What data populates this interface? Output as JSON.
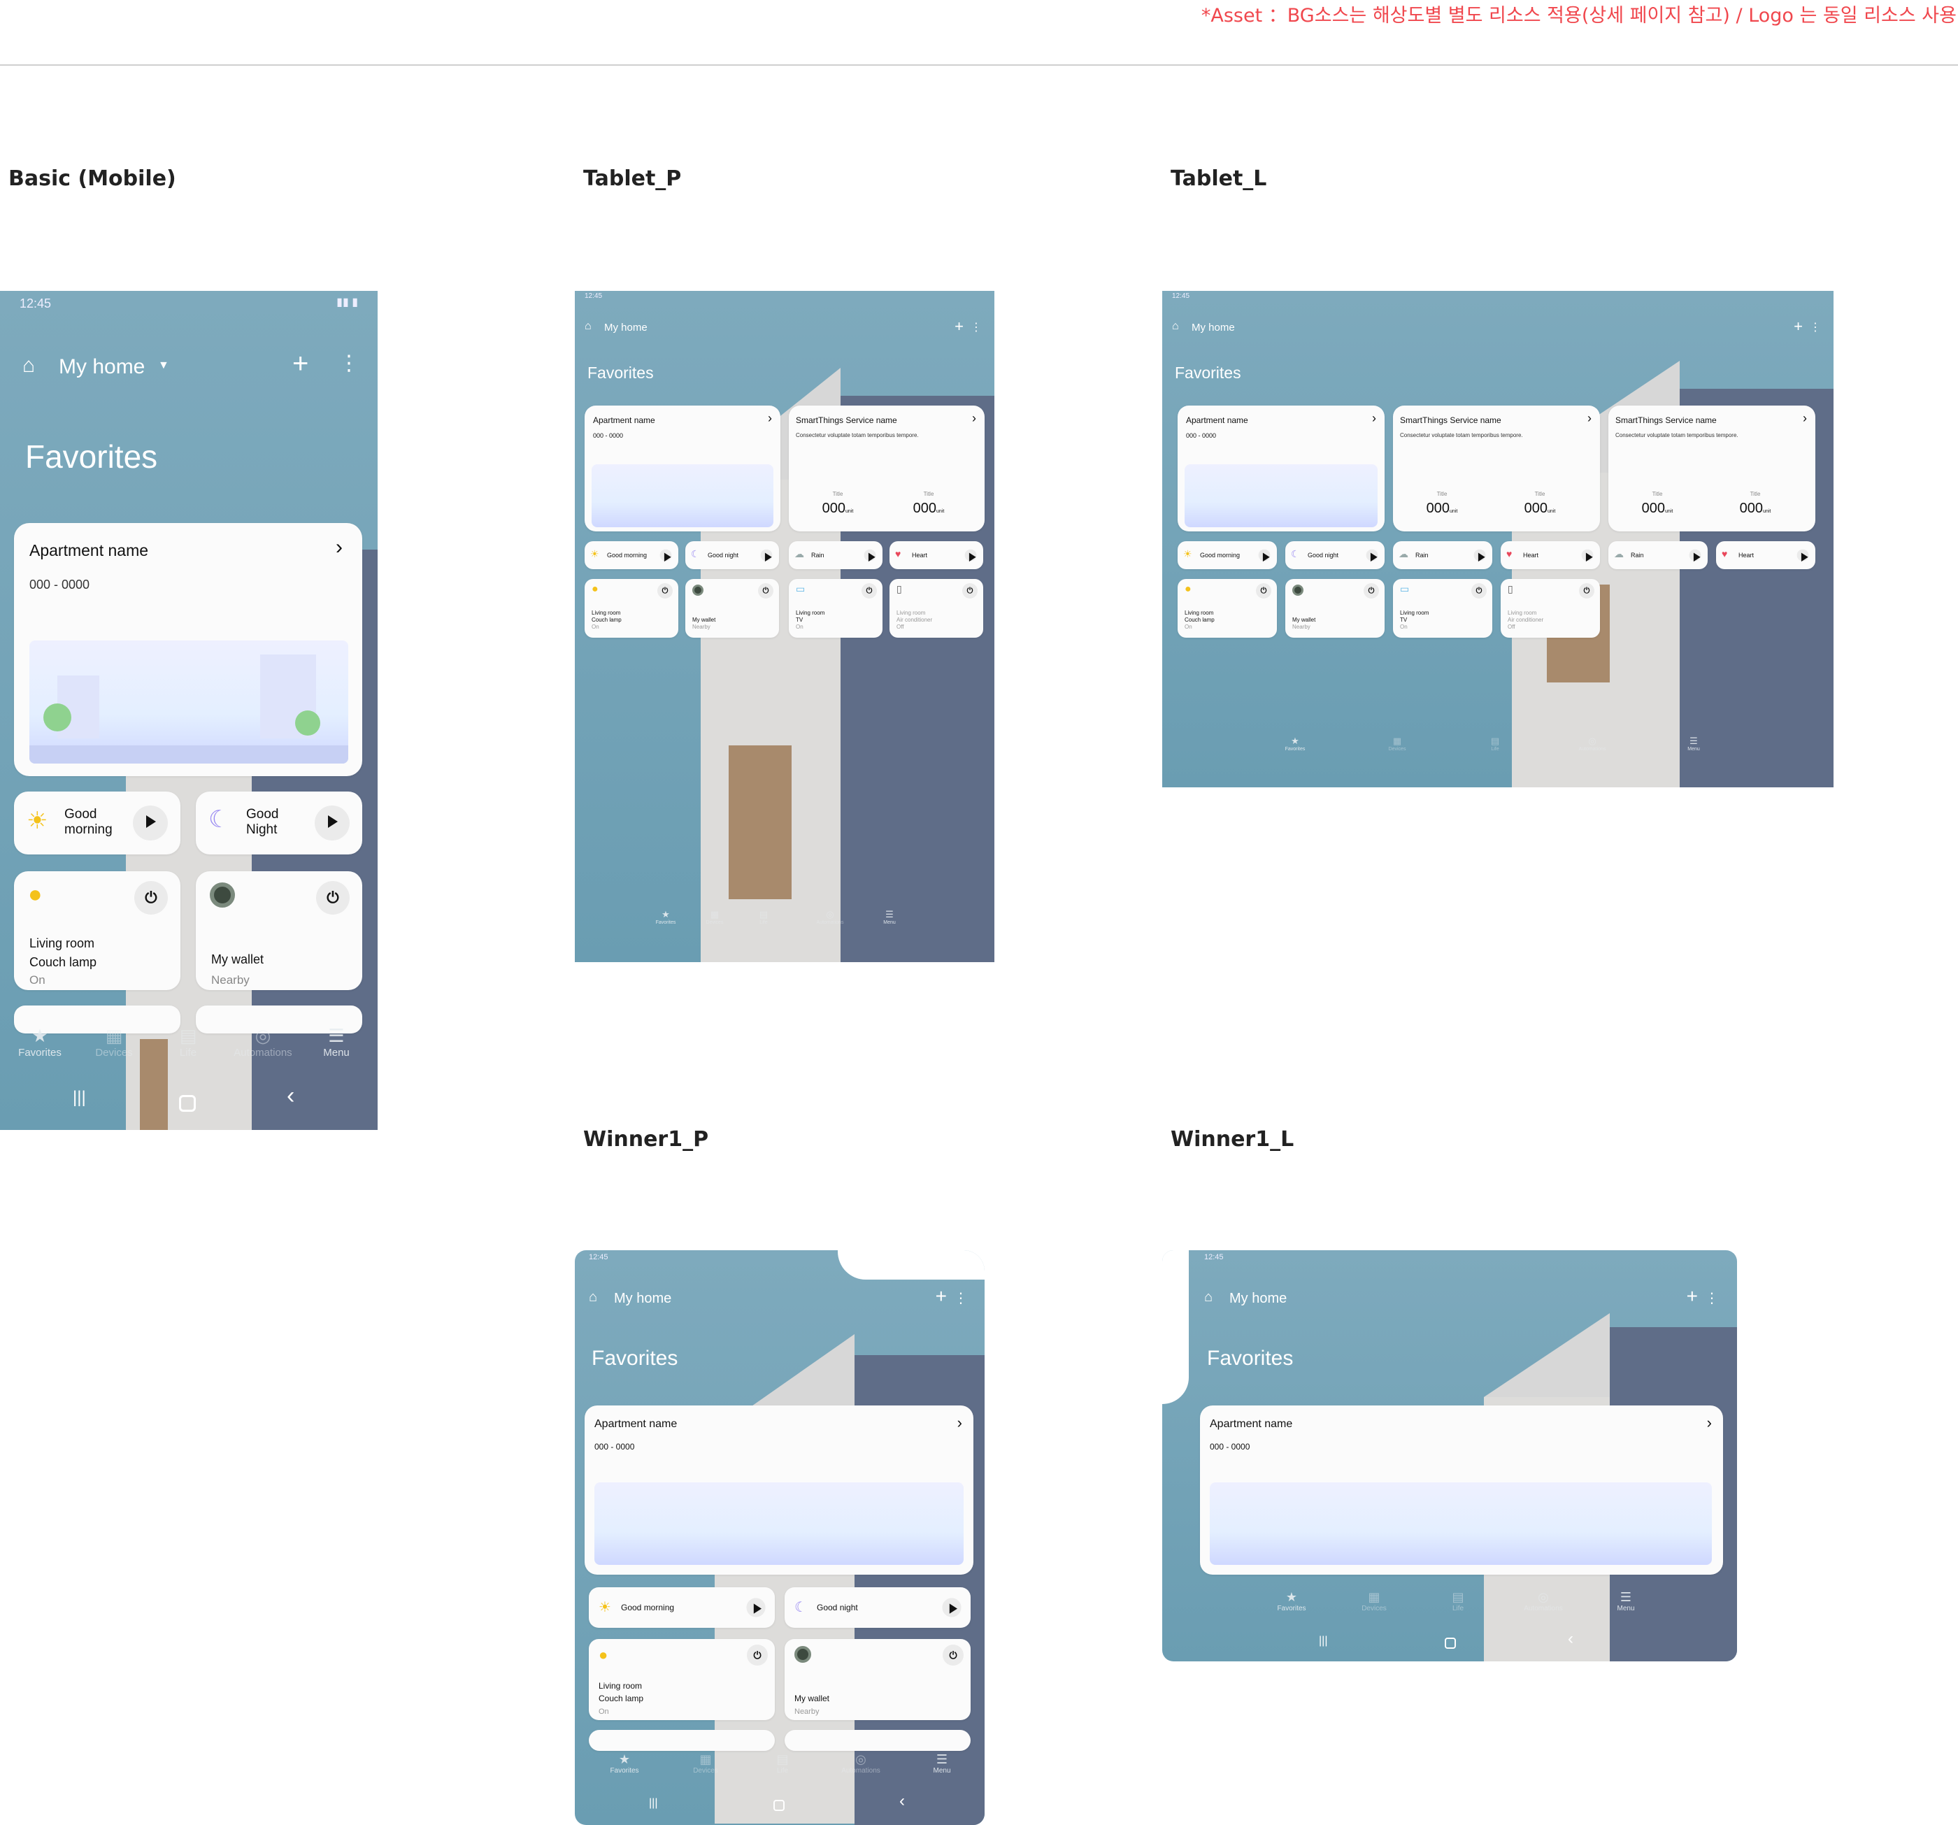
{
  "note": "*Asset ：BG소스는 해상도별 별도 리소스 적용(상세 페이지 참고) / Logo 는 동일 리소스 사용",
  "sections": {
    "mobile": "Basic (Mobile)",
    "tablet_p": "Tablet_P",
    "tablet_l": "Tablet_L",
    "winner_p": "Winner1_P",
    "winner_l": "Winner1_L"
  },
  "app": {
    "time": "12:45",
    "home": "My home",
    "favorites": "Favorites",
    "apartment": "Apartment name",
    "apartment_code": "000 - 0000",
    "service": "SmartThings Service name",
    "service_desc": "Consectetur voluptate totam temporibus tempore.",
    "stat_title": "Title",
    "stat_value": "000",
    "stat_unit": "unit",
    "scenes": {
      "good_morning": "Good morning",
      "good_night": "Good night",
      "good_night_cap": "Good Night",
      "rain": "Rain",
      "heart": "Heart"
    },
    "mobile_scene1_l1": "Good",
    "mobile_scene1_l2": "morning",
    "mobile_scene2_l1": "Good",
    "mobile_scene2_l2": "Night",
    "devices": {
      "lamp_l1": "Living room",
      "lamp_l2": "Couch lamp",
      "lamp_state": "On",
      "wallet": "My wallet",
      "wallet_state": "Nearby",
      "tv_l1": "Living room",
      "tv_l2": "TV",
      "tv_state": "On",
      "ac_l1": "Living room",
      "ac_l2": "Air conditioner",
      "ac_state": "Off"
    },
    "nav": {
      "favorites": "Favorites",
      "devices": "Devices",
      "life": "Life",
      "automations": "Automations",
      "menu": "Menu"
    }
  },
  "colors": {
    "sky": "#7eaabd",
    "note": "#f0474d",
    "card": "#fbfbfb"
  }
}
